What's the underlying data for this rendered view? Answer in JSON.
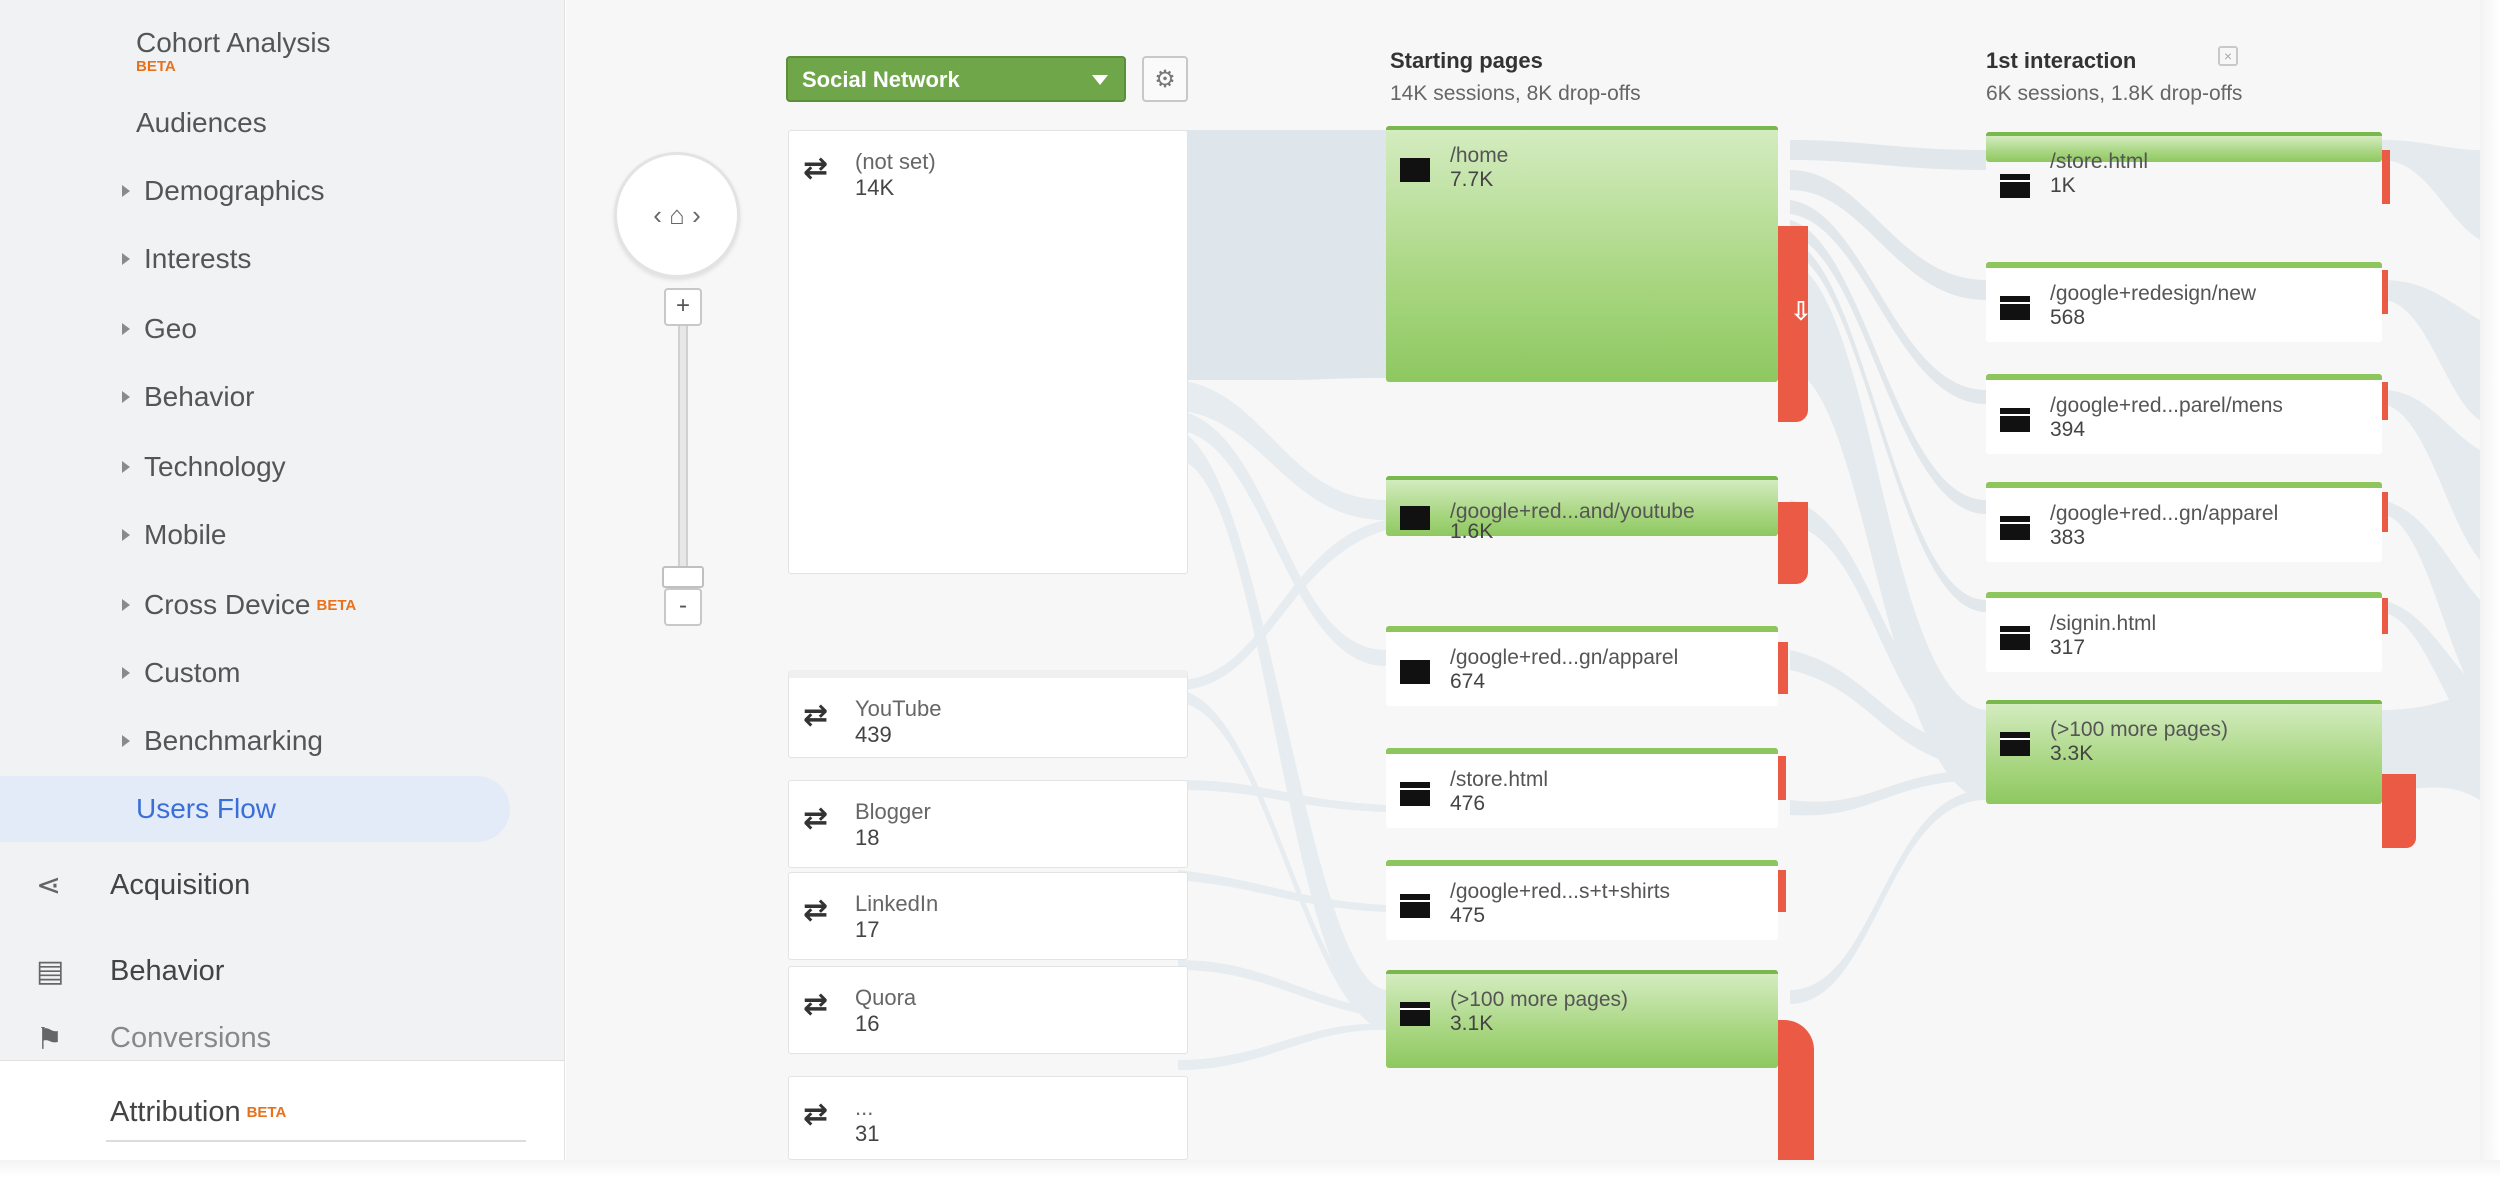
{
  "sidebar": {
    "items": [
      {
        "label": "Cohort Analysis",
        "badge": "BETA"
      },
      {
        "label": "Audiences"
      },
      {
        "label": "Demographics"
      },
      {
        "label": "Interests"
      },
      {
        "label": "Geo"
      },
      {
        "label": "Behavior"
      },
      {
        "label": "Technology"
      },
      {
        "label": "Mobile"
      },
      {
        "label": "Cross Device",
        "badge": "BETA"
      },
      {
        "label": "Custom"
      },
      {
        "label": "Benchmarking"
      },
      {
        "label": "Users Flow"
      }
    ],
    "sections": [
      {
        "label": "Acquisition",
        "icon": "acquisition-icon"
      },
      {
        "label": "Behavior",
        "icon": "behavior-icon"
      },
      {
        "label": "Conversions",
        "icon": "conversions-icon"
      }
    ],
    "attribution": {
      "label": "Attribution",
      "badge": "BETA"
    }
  },
  "toolbar": {
    "dimension": "Social Network",
    "gear_icon": "gear-icon"
  },
  "columns": {
    "starting": {
      "title": "Starting pages",
      "sub": "14K sessions, 8K drop-offs"
    },
    "first": {
      "title": "1st interaction",
      "sub": "6K sessions, 1.8K drop-offs"
    }
  },
  "sources": [
    {
      "name": "(not set)",
      "count": "14K"
    },
    {
      "name": "YouTube",
      "count": "439"
    },
    {
      "name": "Blogger",
      "count": "18"
    },
    {
      "name": "LinkedIn",
      "count": "17"
    },
    {
      "name": "Quora",
      "count": "16"
    },
    {
      "name": "...",
      "count": "31"
    }
  ],
  "starting_pages": [
    {
      "name": "/home",
      "count": "7.7K"
    },
    {
      "name": "/google+red...and/youtube",
      "count": "1.6K"
    },
    {
      "name": "/google+red...gn/apparel",
      "count": "674"
    },
    {
      "name": "/store.html",
      "count": "476"
    },
    {
      "name": "/google+red...s+t+shirts",
      "count": "475"
    },
    {
      "name": "(>100 more pages)",
      "count": "3.1K"
    }
  ],
  "first_interaction": [
    {
      "name": "/store.html",
      "count": "1K"
    },
    {
      "name": "/google+redesign/new",
      "count": "568"
    },
    {
      "name": "/google+red...parel/mens",
      "count": "394"
    },
    {
      "name": "/google+red...gn/apparel",
      "count": "383"
    },
    {
      "name": "/signin.html",
      "count": "317"
    },
    {
      "name": "(>100 more pages)",
      "count": "3.3K"
    }
  ],
  "colors": {
    "node_green": "#8cc65d",
    "dropoff_red": "#ea5a45",
    "flow_gray": "#dfe7ec",
    "active_blue": "#3a6fd8"
  }
}
